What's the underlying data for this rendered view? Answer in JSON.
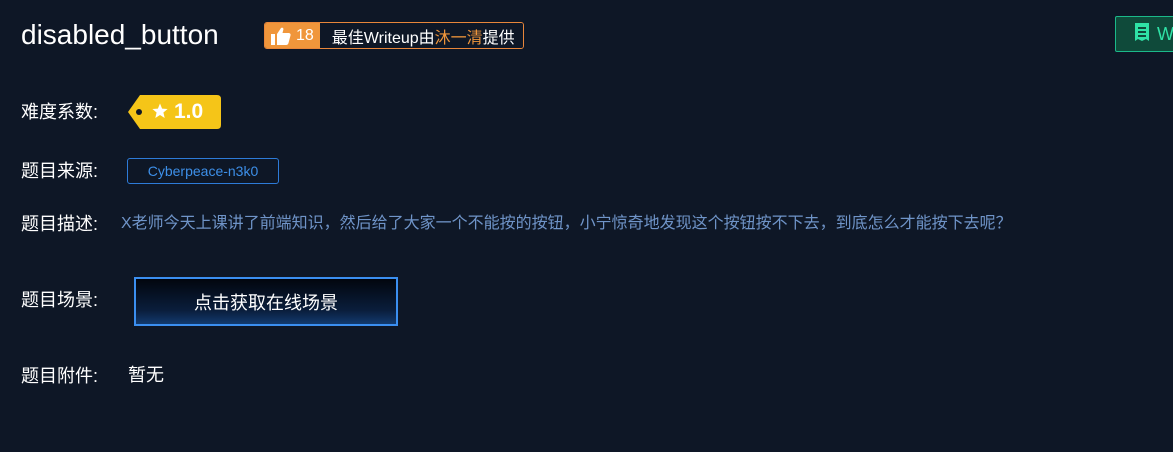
{
  "header": {
    "title": "disabled_button",
    "likes": "18",
    "writeup_prefix": "最佳Writeup由",
    "writeup_author": "沐一清",
    "writeup_suffix": "提供",
    "wp_button_label": "W"
  },
  "difficulty": {
    "label": "难度系数:",
    "value": "1.0",
    "tag_color": "#f5c518"
  },
  "source": {
    "label": "题目来源:",
    "value": "Cyberpeace-n3k0"
  },
  "description": {
    "label": "题目描述:",
    "text": "X老师今天上课讲了前端知识，然后给了大家一个不能按的按钮，小宁惊奇地发现这个按钮按不下去，到底怎么才能按下去呢？"
  },
  "scene": {
    "label": "题目场景:",
    "button_label": "点击获取在线场景"
  },
  "attachment": {
    "label": "题目附件:",
    "value": "暂无"
  },
  "colors": {
    "background": "#0e1726",
    "accent_orange": "#f0963b",
    "accent_blue": "#3b8ff0",
    "accent_green": "#1bb98a"
  },
  "icons": {
    "like": "thumbs-up-icon",
    "difficulty": "star-icon",
    "writeup": "document-icon"
  }
}
